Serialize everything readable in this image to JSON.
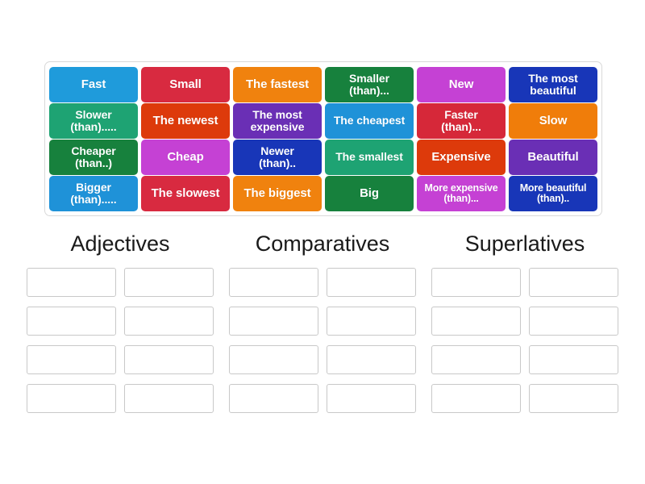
{
  "activity": {
    "type": "group-sort",
    "word_bank": {
      "tiles": [
        {
          "label": "Fast",
          "color": "#1f9bdb",
          "size": "normal"
        },
        {
          "label": "Small",
          "color": "#d82a40",
          "size": "normal"
        },
        {
          "label": "The fastest",
          "color": "#f0820e",
          "size": "normal"
        },
        {
          "label": "Smaller\n(than)...",
          "color": "#17813d",
          "size": "mid"
        },
        {
          "label": "New",
          "color": "#c541d4",
          "size": "normal"
        },
        {
          "label": "The most\nbeautiful",
          "color": "#1836b8",
          "size": "mid"
        },
        {
          "label": "Slower\n(than).....",
          "color": "#1ea373",
          "size": "mid"
        },
        {
          "label": "The newest",
          "color": "#dd3a0b",
          "size": "normal"
        },
        {
          "label": "The most\nexpensive",
          "color": "#6a2fb5",
          "size": "mid"
        },
        {
          "label": "The cheapest",
          "color": "#1f92d8",
          "size": "mid"
        },
        {
          "label": "Faster\n(than)...",
          "color": "#d62839",
          "size": "mid"
        },
        {
          "label": "Slow",
          "color": "#f07d0a",
          "size": "normal"
        },
        {
          "label": "Cheaper\n(than..)",
          "color": "#17813d",
          "size": "mid"
        },
        {
          "label": "Cheap",
          "color": "#c541d4",
          "size": "normal"
        },
        {
          "label": "Newer\n(than)..",
          "color": "#1836b8",
          "size": "mid"
        },
        {
          "label": "The smallest",
          "color": "#1ea373",
          "size": "mid"
        },
        {
          "label": "Expensive",
          "color": "#dd3a0b",
          "size": "normal"
        },
        {
          "label": "Beautiful",
          "color": "#6a2fb5",
          "size": "normal"
        },
        {
          "label": "Bigger\n(than).....",
          "color": "#1f92d8",
          "size": "mid"
        },
        {
          "label": "The slowest",
          "color": "#d82a40",
          "size": "normal"
        },
        {
          "label": "The biggest",
          "color": "#f0820e",
          "size": "normal"
        },
        {
          "label": "Big",
          "color": "#17813d",
          "size": "normal"
        },
        {
          "label": "More expensive\n(than)...",
          "color": "#c541d4",
          "size": "small"
        },
        {
          "label": "More beautiful\n(than)..",
          "color": "#1836b8",
          "size": "small"
        }
      ]
    },
    "categories": [
      {
        "title": "Adjectives",
        "slot_count": 8,
        "slots": [
          "",
          "",
          "",
          "",
          "",
          "",
          "",
          ""
        ]
      },
      {
        "title": "Comparatives",
        "slot_count": 8,
        "slots": [
          "",
          "",
          "",
          "",
          "",
          "",
          "",
          ""
        ]
      },
      {
        "title": "Superlatives",
        "slot_count": 8,
        "slots": [
          "",
          "",
          "",
          "",
          "",
          "",
          "",
          ""
        ]
      }
    ]
  }
}
